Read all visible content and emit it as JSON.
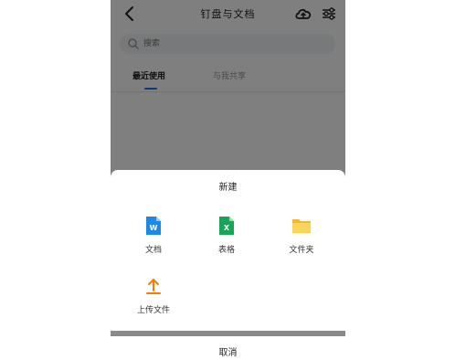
{
  "header": {
    "title": "钉盘与文档",
    "back_icon": "chevron-left-icon",
    "cloud_icon": "cloud-upload-icon",
    "filter_icon": "sliders-icon"
  },
  "search": {
    "placeholder": "搜索"
  },
  "tabs": [
    {
      "label": "最近使用",
      "active": true
    },
    {
      "label": "与我共享",
      "active": false
    }
  ],
  "sheet": {
    "title": "新建",
    "options": [
      {
        "label": "文档",
        "icon": "word-doc-icon",
        "color": "#1e88e5"
      },
      {
        "label": "表格",
        "icon": "excel-sheet-icon",
        "color": "#18a558"
      },
      {
        "label": "文件夹",
        "icon": "folder-icon",
        "color": "#f7c63b"
      },
      {
        "label": "上传文件",
        "icon": "upload-icon",
        "color": "#f57c00"
      }
    ],
    "cancel_label": "取消"
  },
  "colors": {
    "accent": "#1a73e8",
    "overlay": "rgba(0,0,0,0.5)"
  }
}
